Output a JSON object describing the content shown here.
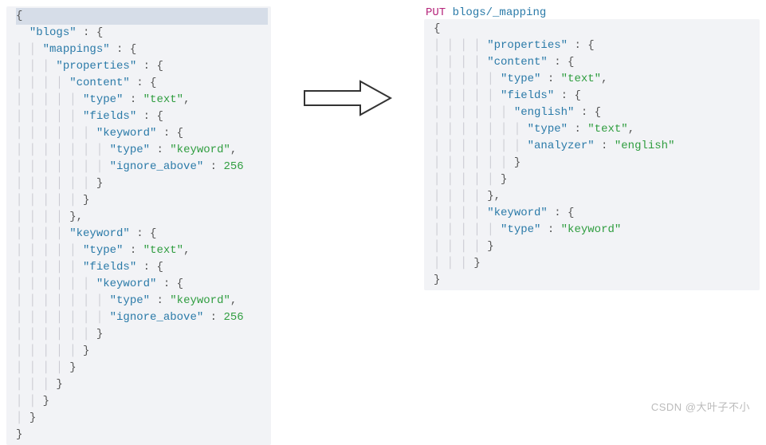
{
  "left": {
    "l1": "{",
    "l2_k": "\"blogs\"",
    "l3_k": "\"mappings\"",
    "l4_k": "\"properties\"",
    "l5_k": "\"content\"",
    "l6_k": "\"type\"",
    "l6_v": "\"text\"",
    "l7_k": "\"fields\"",
    "l8_k": "\"keyword\"",
    "l9_k": "\"type\"",
    "l9_v": "\"keyword\"",
    "l10_k": "\"ignore_above\"",
    "l10_v": "256",
    "l14_k": "\"keyword\"",
    "l15_k": "\"type\"",
    "l15_v": "\"text\"",
    "l16_k": "\"fields\"",
    "l17_k": "\"keyword\"",
    "l18_k": "\"type\"",
    "l18_v": "\"keyword\"",
    "l19_k": "\"ignore_above\"",
    "l19_v": "256"
  },
  "right": {
    "verb": "PUT",
    "path": "blogs/_mapping",
    "r3_k": "\"properties\"",
    "r4_k": "\"content\"",
    "r5_k": "\"type\"",
    "r5_v": "\"text\"",
    "r6_k": "\"fields\"",
    "r7_k": "\"english\"",
    "r8_k": "\"type\"",
    "r8_v": "\"text\"",
    "r9_k": "\"analyzer\"",
    "r9_v": "\"english\"",
    "r13_k": "\"keyword\"",
    "r14_k": "\"type\"",
    "r14_v": "\"keyword\""
  },
  "watermark": "CSDN @大叶子不小"
}
